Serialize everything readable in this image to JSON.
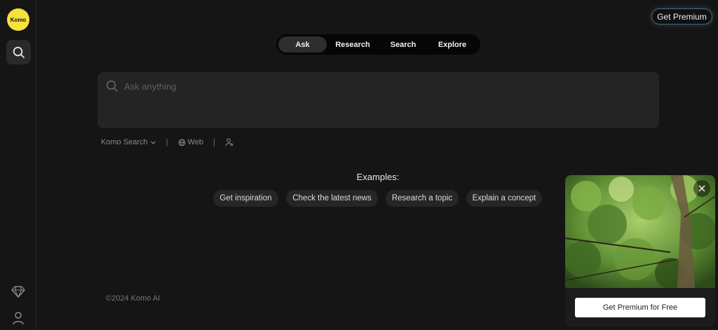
{
  "sidebar": {
    "logo_text": "Komo",
    "icons": [
      "search-icon",
      "gem-icon",
      "user-icon"
    ]
  },
  "header": {
    "premium_label": "Get Premium"
  },
  "tabs": [
    {
      "label": "Ask",
      "active": true
    },
    {
      "label": "Research",
      "active": false
    },
    {
      "label": "Search",
      "active": false
    },
    {
      "label": "Explore",
      "active": false
    }
  ],
  "ask": {
    "placeholder": "Ask anything",
    "value": ""
  },
  "options": {
    "engine_label": "Komo Search",
    "separator": "|",
    "source_label": "Web"
  },
  "examples": {
    "title": "Examples:",
    "chips": [
      "Get inspiration",
      "Check the latest news",
      "Research a topic",
      "Explain a concept"
    ]
  },
  "footer": {
    "copyright": "©2024 Komo AI"
  },
  "promo": {
    "button_label": "Get Premium for Free"
  },
  "colors": {
    "background": "#151515",
    "logo_yellow": "#f5e23a",
    "input_bg": "#242424",
    "chip_bg": "#262626"
  }
}
